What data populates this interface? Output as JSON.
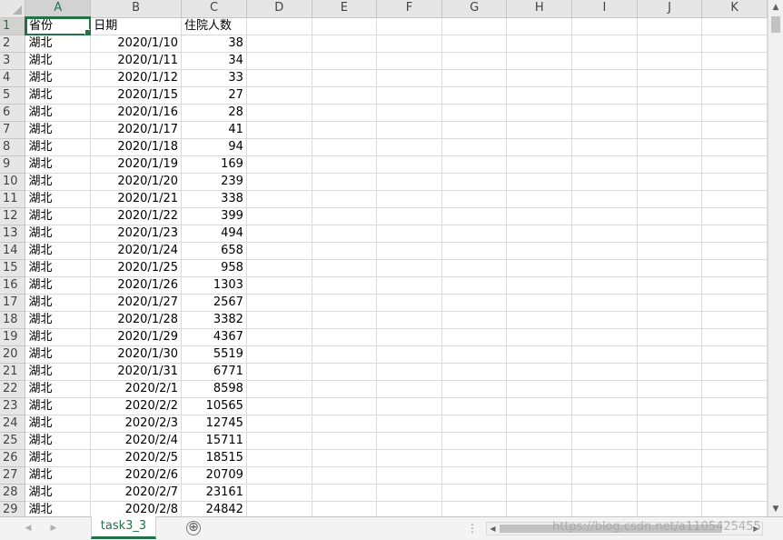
{
  "columns": [
    "A",
    "B",
    "C",
    "D",
    "E",
    "F",
    "G",
    "H",
    "I",
    "J",
    "K"
  ],
  "header_row": {
    "row_number": "1",
    "cells": [
      "省份",
      "日期",
      "住院人数"
    ]
  },
  "rows": [
    {
      "n": "2",
      "province": "湖北",
      "date": "2020/1/10",
      "count": "38"
    },
    {
      "n": "3",
      "province": "湖北",
      "date": "2020/1/11",
      "count": "34"
    },
    {
      "n": "4",
      "province": "湖北",
      "date": "2020/1/12",
      "count": "33"
    },
    {
      "n": "5",
      "province": "湖北",
      "date": "2020/1/15",
      "count": "27"
    },
    {
      "n": "6",
      "province": "湖北",
      "date": "2020/1/16",
      "count": "28"
    },
    {
      "n": "7",
      "province": "湖北",
      "date": "2020/1/17",
      "count": "41"
    },
    {
      "n": "8",
      "province": "湖北",
      "date": "2020/1/18",
      "count": "94"
    },
    {
      "n": "9",
      "province": "湖北",
      "date": "2020/1/19",
      "count": "169"
    },
    {
      "n": "10",
      "province": "湖北",
      "date": "2020/1/20",
      "count": "239"
    },
    {
      "n": "11",
      "province": "湖北",
      "date": "2020/1/21",
      "count": "338"
    },
    {
      "n": "12",
      "province": "湖北",
      "date": "2020/1/22",
      "count": "399"
    },
    {
      "n": "13",
      "province": "湖北",
      "date": "2020/1/23",
      "count": "494"
    },
    {
      "n": "14",
      "province": "湖北",
      "date": "2020/1/24",
      "count": "658"
    },
    {
      "n": "15",
      "province": "湖北",
      "date": "2020/1/25",
      "count": "958"
    },
    {
      "n": "16",
      "province": "湖北",
      "date": "2020/1/26",
      "count": "1303"
    },
    {
      "n": "17",
      "province": "湖北",
      "date": "2020/1/27",
      "count": "2567"
    },
    {
      "n": "18",
      "province": "湖北",
      "date": "2020/1/28",
      "count": "3382"
    },
    {
      "n": "19",
      "province": "湖北",
      "date": "2020/1/29",
      "count": "4367"
    },
    {
      "n": "20",
      "province": "湖北",
      "date": "2020/1/30",
      "count": "5519"
    },
    {
      "n": "21",
      "province": "湖北",
      "date": "2020/1/31",
      "count": "6771"
    },
    {
      "n": "22",
      "province": "湖北",
      "date": "2020/2/1",
      "count": "8598"
    },
    {
      "n": "23",
      "province": "湖北",
      "date": "2020/2/2",
      "count": "10565"
    },
    {
      "n": "24",
      "province": "湖北",
      "date": "2020/2/3",
      "count": "12745"
    },
    {
      "n": "25",
      "province": "湖北",
      "date": "2020/2/4",
      "count": "15711"
    },
    {
      "n": "26",
      "province": "湖北",
      "date": "2020/2/5",
      "count": "18515"
    },
    {
      "n": "27",
      "province": "湖北",
      "date": "2020/2/6",
      "count": "20709"
    },
    {
      "n": "28",
      "province": "湖北",
      "date": "2020/2/7",
      "count": "23161"
    },
    {
      "n": "29",
      "province": "湖北",
      "date": "2020/2/8",
      "count": "24842"
    }
  ],
  "sheet_tab": "task3_3",
  "add_sheet_label": "⊕",
  "watermark": "https://blog.csdn.net/a1105425455",
  "icons": {
    "scroll_up": "up-arrow-icon",
    "scroll_down": "down-arrow-icon",
    "scroll_left": "left-arrow-icon",
    "scroll_right": "right-arrow-icon",
    "tab_prev": "tab-prev-icon",
    "tab_next": "tab-next-icon",
    "add_sheet": "add-sheet-icon"
  },
  "colors": {
    "accent": "#217346",
    "header_bg": "#e6e6e6",
    "gridline": "#dadada"
  }
}
